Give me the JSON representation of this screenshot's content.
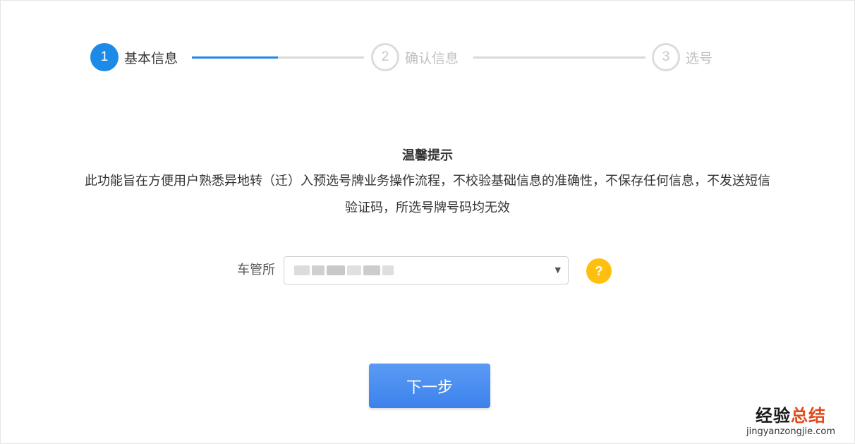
{
  "stepper": {
    "steps": [
      {
        "number": "1",
        "label": "基本信息",
        "state": "active"
      },
      {
        "number": "2",
        "label": "确认信息",
        "state": "inactive"
      },
      {
        "number": "3",
        "label": "选号",
        "state": "inactive"
      }
    ],
    "progress_first_connector": 0.5,
    "accent_color": "#1e8ae8",
    "inactive_color": "#d9d9d9"
  },
  "tips": {
    "title": "温馨提示",
    "line1": "此功能旨在方便用户熟悉异地转（迁）入预选号牌业务操作流程，不校验基础信息的准确性，不保存任何信息，不发送短信",
    "line2": "验证码，所选号牌号码均无效"
  },
  "form": {
    "office_label": "车管所",
    "office_value_redacted": true,
    "caret_icon": "triangle-down-icon",
    "help_badge": "?",
    "help_color": "#ffbf0f"
  },
  "actions": {
    "next_label": "下一步",
    "button_color": "#4a8ef0"
  },
  "watermark": {
    "brand_part1": "经验",
    "brand_part2": "总结",
    "url": "jingyanzongjie.com"
  }
}
